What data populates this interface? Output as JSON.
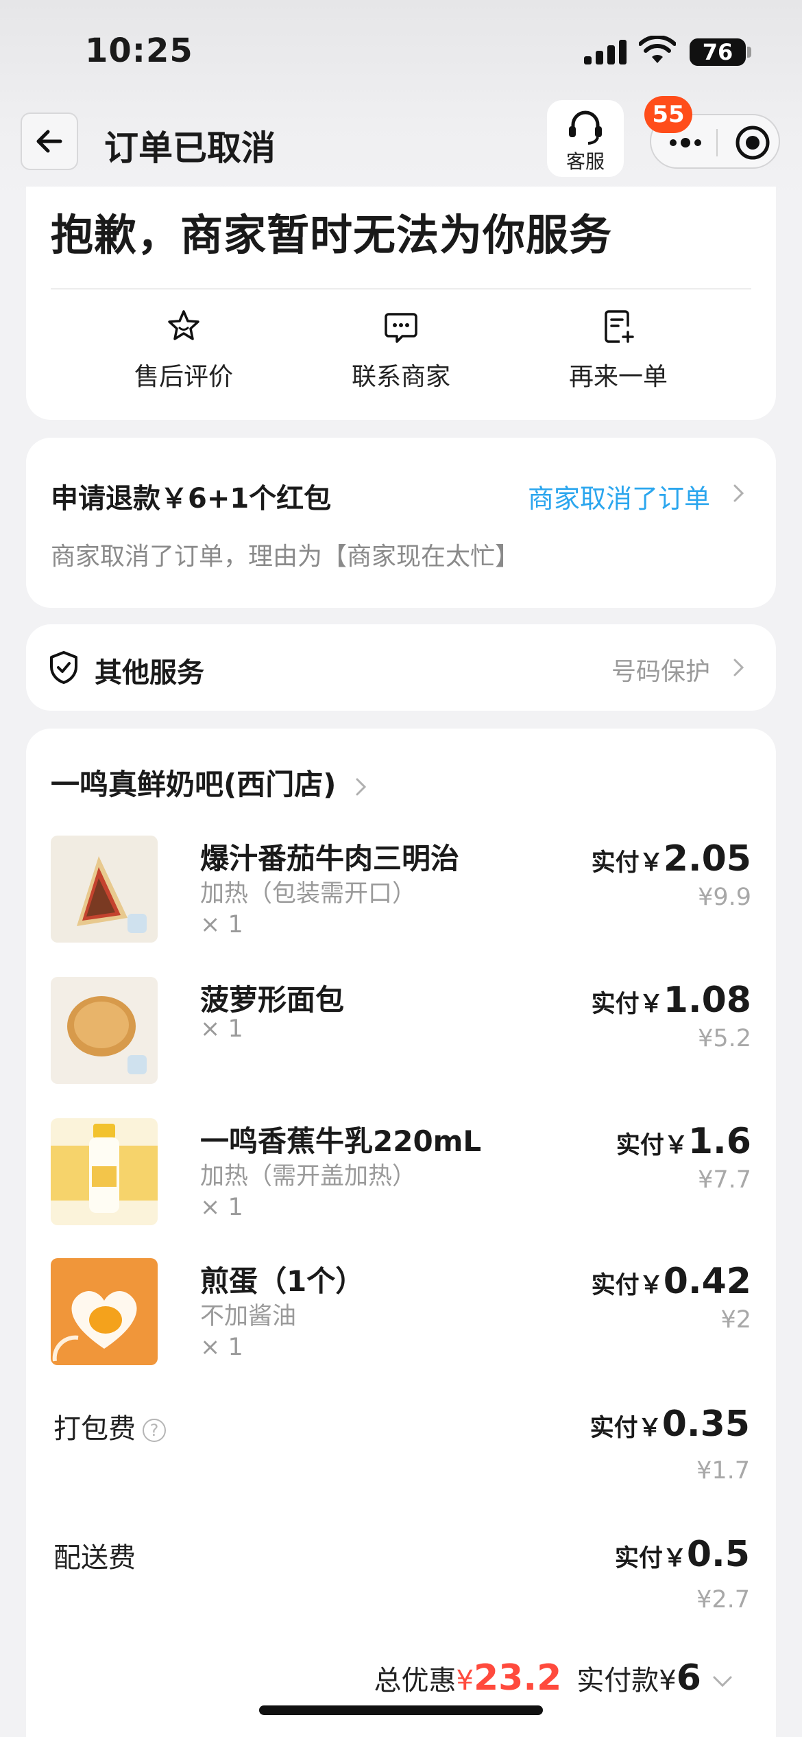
{
  "status_bar": {
    "time": "10:25",
    "battery": "76"
  },
  "nav": {
    "title": "订单已取消",
    "customer_service": "客服",
    "badge_count": "55"
  },
  "header_card": {
    "headline": "抱歉，商家暂时无法为你服务",
    "actions": [
      {
        "label": "售后评价",
        "icon": "star-icon"
      },
      {
        "label": "联系商家",
        "icon": "chat-icon"
      },
      {
        "label": "再来一单",
        "icon": "reorder-icon"
      }
    ]
  },
  "refund": {
    "title": "申请退款￥6+1个红包",
    "status": "商家取消了订单",
    "reason": "商家取消了订单，理由为【商家现在太忙】"
  },
  "other_services": {
    "title": "其他服务",
    "link": "号码保护"
  },
  "store": {
    "name": "一鸣真鲜奶吧(西门店)",
    "items": [
      {
        "name": "爆汁番茄牛肉三明治",
        "spec": "加热（包装需开口）",
        "qty": "× 1",
        "paid_label": "实付￥",
        "paid": "2.05",
        "original": "¥9.9"
      },
      {
        "name": "菠萝形面包",
        "spec": "",
        "qty": "× 1",
        "paid_label": "实付￥",
        "paid": "1.08",
        "original": "¥5.2"
      },
      {
        "name": "一鸣香蕉牛乳220mL",
        "spec": "加热（需开盖加热）",
        "qty": "× 1",
        "paid_label": "实付￥",
        "paid": "1.6",
        "original": "¥7.7"
      },
      {
        "name": "煎蛋（1个）",
        "spec": "不加酱油",
        "qty": "× 1",
        "paid_label": "实付￥",
        "paid": "0.42",
        "original": "¥2"
      }
    ],
    "packing_fee": {
      "label": "打包费",
      "paid_label": "实付￥",
      "paid": "0.35",
      "original": "¥1.7"
    },
    "delivery_fee": {
      "label": "配送费",
      "paid_label": "实付￥",
      "paid": "0.5",
      "original": "¥2.7"
    },
    "totals": {
      "discount_label": "总优惠",
      "discount_currency": "¥",
      "discount": "23.2",
      "paid_label": "实付款¥",
      "paid": "6"
    }
  },
  "colors": {
    "accent_blue": "#2ba6ee",
    "discount_red": "#ff4a3d",
    "badge": "#ff4d1a"
  }
}
